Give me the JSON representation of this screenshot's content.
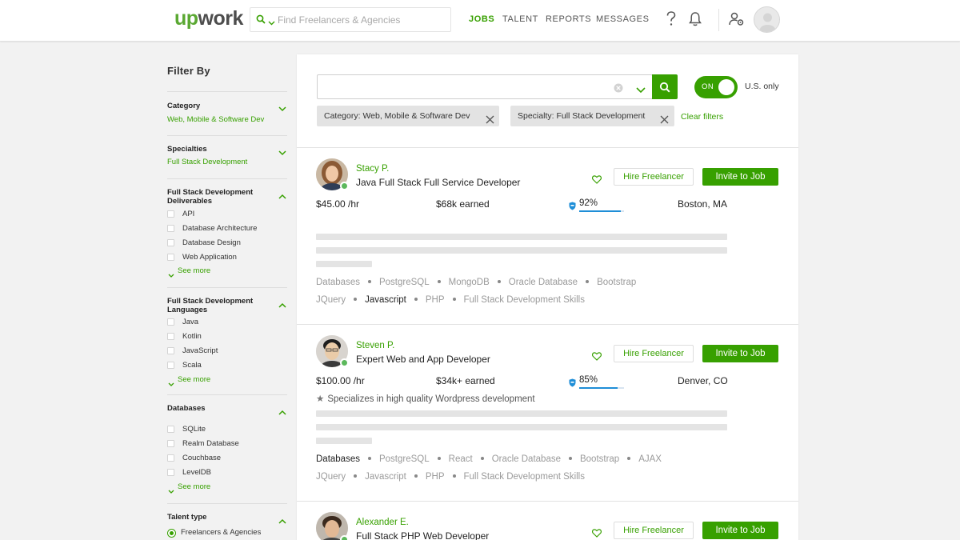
{
  "header": {
    "logo": {
      "w": "up",
      "rest": "work"
    },
    "search_placeholder": "Find Freelancers & Agencies",
    "nav": [
      {
        "label": "JOBS",
        "active": true
      },
      {
        "label": "TALENT",
        "active": false
      },
      {
        "label": "REPORTS",
        "active": false
      },
      {
        "label": "MESSAGES",
        "active": false
      }
    ]
  },
  "sidebar": {
    "title": "Filter By",
    "category": {
      "title": "Category",
      "value": "Web, Mobile & Software Dev"
    },
    "specialties": {
      "title": "Specialties",
      "value": "Full Stack Development"
    },
    "deliverables": {
      "title": "Full Stack Development Deliverables",
      "items": [
        "API",
        "Database Architecture",
        "Database Design",
        "Web Application"
      ],
      "see_more": "See more"
    },
    "languages": {
      "title": "Full Stack Development Languages",
      "items": [
        "Java",
        "Kotlin",
        "JavaScript",
        "Scala"
      ],
      "see_more": "See more"
    },
    "databases": {
      "title": "Databases",
      "items": [
        "SQLite",
        "Realm Database",
        "Couchbase",
        "LevelDB"
      ],
      "see_more": "See more"
    },
    "talent_type": {
      "title": "Talent type",
      "selected": "Freelancers & Agencies"
    }
  },
  "main": {
    "search_value": "",
    "toggle_label": "ON",
    "us_only_label": "U.S. only",
    "chips": [
      "Category: Web, Mobile & Software Dev",
      "Specialty: Full Stack Development"
    ],
    "clear_filters": "Clear filters",
    "hire_label": "Hire Freelancer",
    "invite_label": "Invite to Job",
    "freelancers": [
      {
        "name": "Stacy P.",
        "title": "Java Full Stack Full Service Developer",
        "rate": "$45.00 /hr",
        "earned": "$68k earned",
        "score": "92%",
        "score_fraction": 0.92,
        "location": "Boston, MA",
        "skills_row1": [
          "Databases",
          "PostgreSQL",
          "MongoDB",
          "Oracle Database",
          "Bootstrap"
        ],
        "skills_row2": [
          "JQuery",
          "Javascript",
          "PHP",
          "Full Stack Development Skills"
        ],
        "highlighted": [
          "Javascript"
        ]
      },
      {
        "name": "Steven P.",
        "title": "Expert Web and App Developer",
        "rate": "$100.00 /hr",
        "earned": "$34k+ earned",
        "score": "85%",
        "score_fraction": 0.85,
        "location": "Denver, CO",
        "specialty": "Specializes in high quality Wordpress development",
        "skills_row1": [
          "Databases",
          "PostgreSQL",
          "React",
          "Oracle Database",
          "Bootstrap",
          "AJAX"
        ],
        "skills_row2": [
          "JQuery",
          "Javascript",
          "PHP",
          "Full Stack Development Skills"
        ],
        "highlighted": [
          "Databases"
        ]
      },
      {
        "name": "Alexander E.",
        "title": "Full Stack PHP Web Developer"
      }
    ]
  },
  "colors": {
    "brand_green": "#37a000",
    "score_blue": "#1f8ed7"
  }
}
